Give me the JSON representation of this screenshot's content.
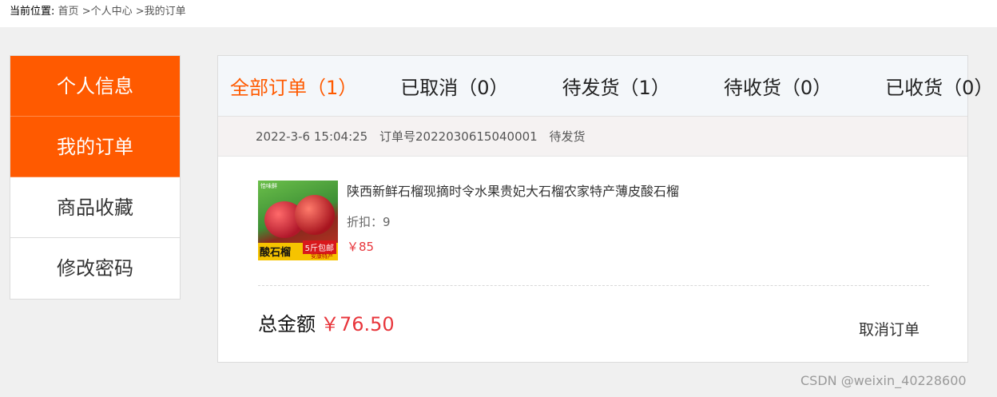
{
  "breadcrumb": {
    "label": "当前位置:",
    "items": [
      "首页",
      ">个人中心",
      ">我的订单"
    ]
  },
  "sidebar": {
    "items": [
      {
        "label": "个人信息",
        "active": true
      },
      {
        "label": "我的订单",
        "active": true
      },
      {
        "label": "商品收藏",
        "active": false
      },
      {
        "label": "修改密码",
        "active": false
      }
    ]
  },
  "tabs": [
    {
      "label": "全部订单（1）",
      "active": true
    },
    {
      "label": "已取消（0）",
      "active": false
    },
    {
      "label": "待发货（1）",
      "active": false
    },
    {
      "label": "待收货（0）",
      "active": false
    },
    {
      "label": "已收货（0）",
      "active": false
    }
  ],
  "order": {
    "datetime": "2022-3-6 15:04:25",
    "order_no": "订单号2022030615040001",
    "status": "待发货",
    "product": {
      "name": "陕西新鲜石榴现摘时令水果贵妃大石榴农家特产薄皮酸石榴",
      "discount": "折扣：9",
      "price": "￥85",
      "image_text": {
        "title": "酸石榴",
        "tag": "5斤包邮",
        "sub": "安康特产",
        "brand": "恰味鲜"
      }
    },
    "total_label": "总金额",
    "total_value": "￥76.50",
    "cancel_label": "取消订单"
  },
  "watermark": "CSDN @weixin_40228600",
  "colors": {
    "accent": "#ff5a00",
    "price": "#e8363c",
    "page_bg": "#f0f0f0"
  }
}
